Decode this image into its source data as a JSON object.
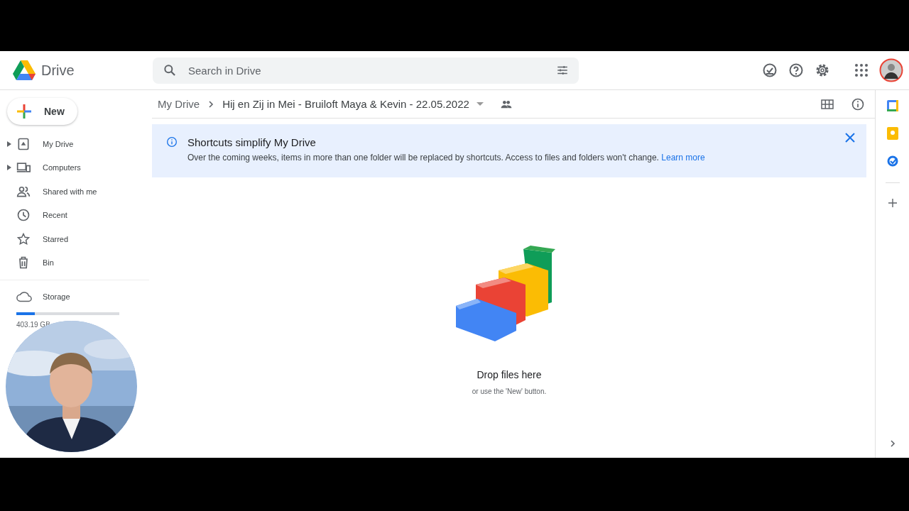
{
  "header": {
    "app_name": "Drive",
    "search": {
      "placeholder": "Search in Drive"
    }
  },
  "sidebar": {
    "new_button": "New",
    "items": [
      {
        "label": "My Drive",
        "kind": "expandable"
      },
      {
        "label": "Computers",
        "kind": "expandable"
      },
      {
        "label": "Shared with me",
        "kind": "plain"
      },
      {
        "label": "Recent",
        "kind": "plain"
      },
      {
        "label": "Starred",
        "kind": "plain"
      },
      {
        "label": "Bin",
        "kind": "plain"
      }
    ],
    "storage": {
      "label": "Storage",
      "level": 0.18,
      "usage": "403.19 GB"
    }
  },
  "breadcrumb": [
    "My Drive",
    "Hij en Zij in Mei - Bruiloft Maya & Kevin - 22.05.2022"
  ],
  "banner": {
    "title": "Shortcuts simplify My Drive",
    "text": "Over the coming weeks, items in more than one folder will be replaced by shortcuts. Access to files and folders won't change.",
    "link": "Learn more"
  },
  "empty_state": {
    "title": "Drop files here",
    "subtitle": "or use the 'New' button."
  }
}
